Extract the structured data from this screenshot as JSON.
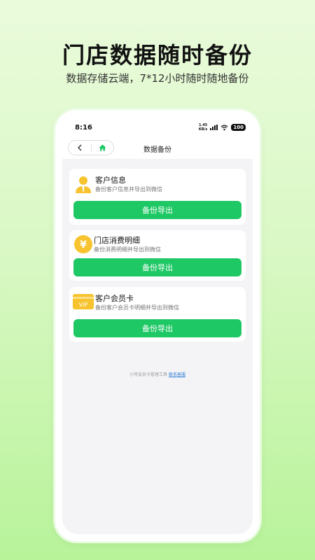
{
  "promo": {
    "headline": "门店数据随时备份",
    "subheadline": "数据存储云端，7*12小时随时随地备份"
  },
  "status_bar": {
    "time": "8:16",
    "net_speed_value": "1.45",
    "net_speed_unit": "KB/s",
    "battery": "100"
  },
  "nav": {
    "back_icon": "chevron-left-icon",
    "home_icon": "home-icon",
    "title": "数据备份"
  },
  "cards": [
    {
      "icon": "user-icon",
      "title": "客户信息",
      "desc": "备份客户信息并导出到微信",
      "button": "备份导出"
    },
    {
      "icon": "yuan-coin-icon",
      "icon_text": "¥",
      "title": "门店消费明细",
      "desc": "备份消费明细并导出到微信",
      "button": "备份导出"
    },
    {
      "icon": "vip-card-icon",
      "icon_text": "VIP",
      "title": "客户会员卡",
      "desc": "备份客户会员卡明细并导出到微信",
      "button": "备份导出"
    }
  ],
  "footer": {
    "text": "小可会员卡管理工具",
    "link": "联系客服"
  },
  "colors": {
    "accent": "#1ec864",
    "icon_yellow": "#f7c32e",
    "link": "#2f7fd6"
  }
}
